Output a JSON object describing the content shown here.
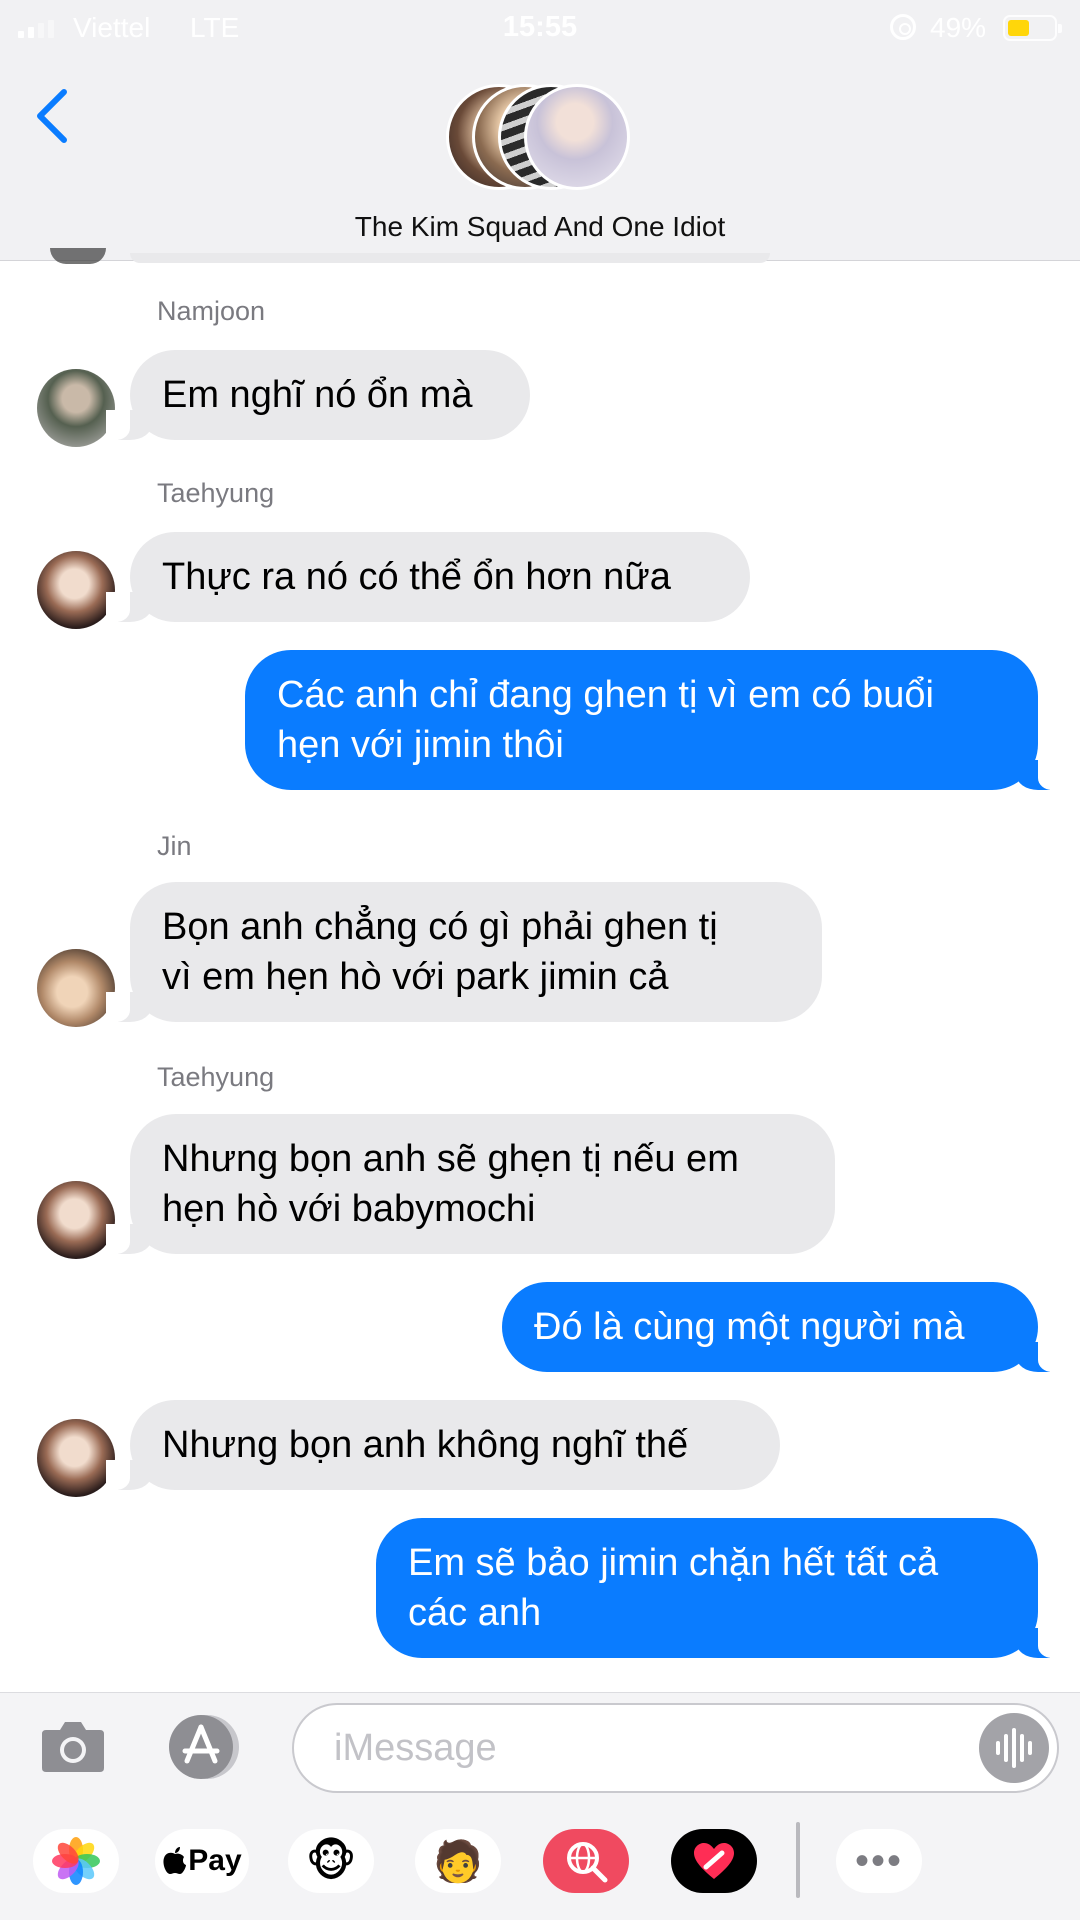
{
  "status_bar": {
    "carrier": "Viettel",
    "network": "LTE",
    "time": "15:55",
    "battery": "49%"
  },
  "header": {
    "title": "The Kim Squad And One Idiot",
    "back_icon": "chevron-left-icon"
  },
  "messages": [
    {
      "id": "m1",
      "sender": "Namjoon",
      "direction": "incoming",
      "text": "Em nghĩ nó ổn mà"
    },
    {
      "id": "m2",
      "sender": "Taehyung",
      "direction": "incoming",
      "text": "Thực ra nó có thể ổn hơn nữa"
    },
    {
      "id": "m3",
      "direction": "outgoing",
      "line1": "Các anh chỉ đang ghen tị vì em có buổi",
      "line2": "hẹn với jimin thôi"
    },
    {
      "id": "m4",
      "sender": "Jin",
      "direction": "incoming",
      "line1": "Bọn anh chẳng có gì phải ghen tị",
      "line2": "vì em hẹn hò với park jimin cả"
    },
    {
      "id": "m5",
      "sender": "Taehyung",
      "direction": "incoming",
      "line1": "Nhưng bọn anh sẽ ghẹn tị nếu em",
      "line2": "hẹn hò với babymochi"
    },
    {
      "id": "m6",
      "direction": "outgoing",
      "text": "Đó là cùng một người mà"
    },
    {
      "id": "m7",
      "direction": "incoming",
      "text": "Nhưng bọn anh không nghĩ thế"
    },
    {
      "id": "m8",
      "direction": "outgoing",
      "line1": "Em sẽ bảo jimin chặn hết tất cả",
      "line2": "các anh"
    }
  ],
  "compose": {
    "placeholder": "iMessage",
    "apple_pay_label": "Pay",
    "more_label": "•••"
  },
  "colors": {
    "outgoing_bubble": "#0a7cff",
    "incoming_bubble": "#e9e9eb",
    "accent": "#0a7cff",
    "battery_fill": "#ffd60a"
  }
}
